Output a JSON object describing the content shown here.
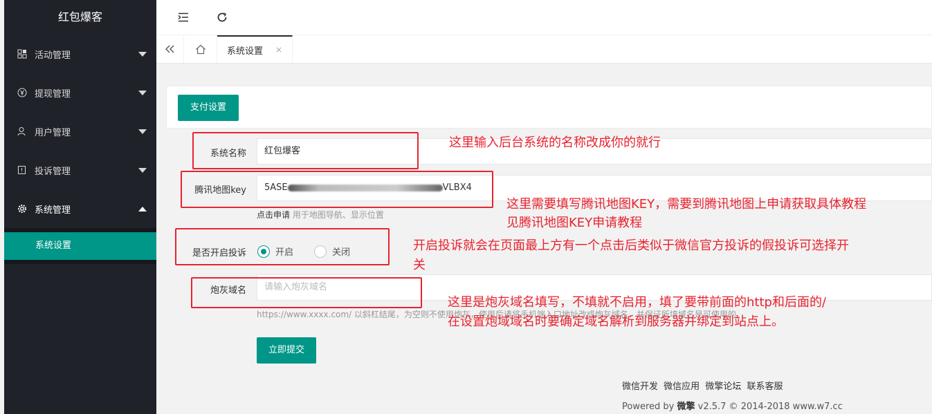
{
  "sidebar": {
    "title": "红包爆客",
    "items": [
      {
        "label": "活动管理",
        "icon": "grid-icon"
      },
      {
        "label": "提现管理",
        "icon": "yen-icon"
      },
      {
        "label": "用户管理",
        "icon": "user-icon"
      },
      {
        "label": "投诉管理",
        "icon": "report-icon"
      },
      {
        "label": "系统管理",
        "icon": "gear-icon"
      }
    ],
    "sub_items": [
      {
        "label": "系统设置"
      }
    ]
  },
  "header": {
    "menu_icon": "menu-fold-icon",
    "refresh_icon": "refresh-icon"
  },
  "tabs": {
    "active_label": "系统设置",
    "close_glyph": "×"
  },
  "card": {
    "pay_button": "支付设置"
  },
  "form": {
    "system_name": {
      "label": "系统名称",
      "value": "红包爆客"
    },
    "map_key": {
      "label": "腾讯地图key",
      "value_start": "5ASE",
      "value_end": "VLBX4",
      "help_link": "点击申请",
      "help_text": "用于地图导航、显示位置"
    },
    "complaint": {
      "label": "是否开启投诉",
      "on": "开启",
      "off": "关闭",
      "selected": "开启"
    },
    "cannon_domain": {
      "label": "炮灰域名",
      "placeholder": "请输入炮灰域名",
      "help_text": "https://www.xxxx.com/ 以斜杠结尾，为空则不使用炮灰，使用后请将手机端入口地址改成炮灰域名，并保证所填域名是可使用的。"
    },
    "submit": "立即提交"
  },
  "notes": {
    "n1": "这里输入后台系统的名称改成你的就行",
    "n2_line1": "这里需要填写腾讯地图KEY，需要到腾讯地图上申请获取具体教程",
    "n2_line2": "见腾讯地图KEY申请教程",
    "n3_line1": "开启投诉就会在页面最上方有一个点击后类似于微信官方投诉的假投诉可选择开",
    "n3_line2": "关",
    "n4_line1": "这里是炮灰域名填写，不填就不启用，填了要带前面的http和后面的/",
    "n4_line2": "在设置炮域域名时要确定域名解析到服务器并绑定到站点上。"
  },
  "footer": {
    "links": [
      "微信开发",
      "微信应用",
      "微擎论坛",
      "联系客服"
    ],
    "powered_prefix": "Powered by",
    "brand": "微擎",
    "powered_suffix": "v2.5.7 © 2014-2018 www.w7.cc"
  },
  "colors": {
    "accent": "#009688",
    "sidebar_bg": "#20222a",
    "annotation": "#e8232f"
  }
}
